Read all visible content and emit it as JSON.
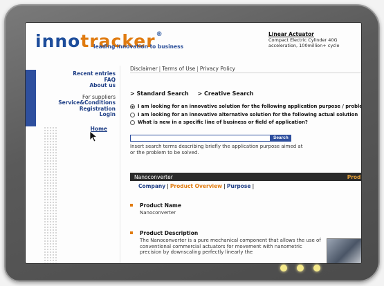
{
  "header": {
    "logo_part1": "inno",
    "logo_part2": "tracker",
    "logo_mark": "®",
    "tagline": "leading innovation to business"
  },
  "ad": {
    "title": "Linear Actuator",
    "line1": "Compact Electric Cylinder 40G",
    "line2": "acceleration, 100million+ cycle"
  },
  "nav": {
    "recent": "Recent entries",
    "faq": "FAQ",
    "about": "About us",
    "suppliers": "For suppliers",
    "service": "Service&Conditions",
    "registration": "Registration",
    "login": "Login",
    "home": "Home"
  },
  "top_links": {
    "disclaimer": "Disclaimer",
    "terms": "Terms of Use",
    "privacy": "Privacy Policy"
  },
  "search_tabs": {
    "standard": "> Standard Search",
    "creative": "> Creative Search"
  },
  "options": [
    "I am looking for an innovative solution for the following application purpose / probler",
    "I am looking for an innovative alternative solution for the following actual solution",
    "What is new in a specific line of business or field of application?"
  ],
  "search": {
    "button": "Search",
    "value": "",
    "hint": "Insert search terms describing briefly the application purpose aimed at or the problem to be solved."
  },
  "section": {
    "name": "Nanoconverter",
    "more": "Prodi"
  },
  "subtabs": {
    "company": "Company",
    "overview": "Product Overview",
    "purpose": "Purpose"
  },
  "product": {
    "name_label": "Product Name",
    "name_value": "Nanoconverter",
    "desc_label": "Product Description",
    "desc_value": "The Nanoconverter is a pure mechanical component that allows the use of conventional commercial actuators for movement with nanometric precision by downscaling perfectly linearly the"
  },
  "colors": {
    "brand_blue": "#1d4d9b",
    "brand_orange": "#e07b10",
    "bar_dark": "#2b2b2b"
  }
}
